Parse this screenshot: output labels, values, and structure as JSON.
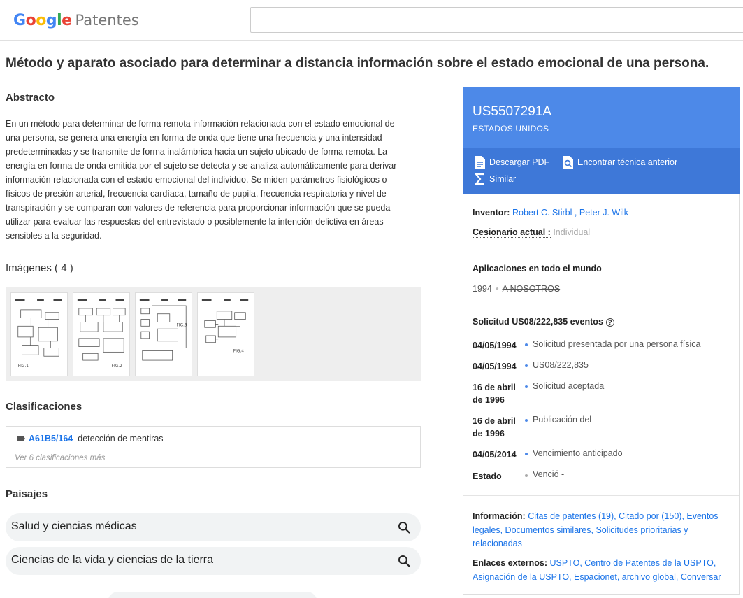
{
  "header": {
    "logo_google": "Google",
    "logo_patentes": "Patentes",
    "search_value": ""
  },
  "title": "Método y aparato asociado para determinar a distancia información sobre el estado emocional de una persona.",
  "abstract": {
    "heading": "Abstracto",
    "text": "En un método para determinar de forma remota información relacionada con el estado emocional de una persona, se genera una energía en forma de onda que tiene una frecuencia y una intensidad predeterminadas y se transmite de forma inalámbrica hacia un sujeto ubicado de forma remota. La energía en forma de onda emitida por el sujeto se detecta y se analiza automáticamente para derivar información relacionada con el estado emocional del individuo. Se miden parámetros fisiológicos o físicos de presión arterial, frecuencia cardíaca, tamaño de pupila, frecuencia respiratoria y nivel de transpiración y se comparan con valores de referencia para proporcionar información que se pueda utilizar para evaluar las respuestas del entrevistado o posiblemente la intención delictiva en áreas sensibles a la seguridad."
  },
  "images": {
    "heading": "Imágenes ( 4 )",
    "thumbnails": [
      "FIG.1",
      "FIG.2",
      "FIG.3",
      "FIG.4"
    ]
  },
  "classifications": {
    "heading": "Clasificaciones",
    "primary_code": "A61B5/164",
    "primary_desc": "detección de mentiras",
    "more": "Ver 6 clasificaciones más"
  },
  "landscapes": {
    "heading": "Paisajes",
    "items": [
      "Salud y ciencias médicas",
      "Ciencias de la vida y ciencias de la tierra"
    ]
  },
  "patent": {
    "number": "US5507291A",
    "country": "ESTADOS UNIDOS",
    "actions": {
      "download": "Descargar PDF",
      "prior_art": "Encontrar técnica anterior",
      "similar": "Similar"
    },
    "inventor_label": "Inventor:",
    "inventors": [
      "Robert C. Stirbl",
      "Peter J. Wilk"
    ],
    "assignee_label": "Cesionario actual :",
    "assignee": "Individual",
    "worldwide_heading": "Aplicaciones en todo el mundo",
    "worldwide_year": "1994",
    "worldwide_country": "A NOSOTROS",
    "application_heading": "Solicitud US08/222,835 eventos",
    "events": [
      {
        "date": "04/05/1994",
        "text": "Solicitud presentada por una persona física"
      },
      {
        "date": "04/05/1994",
        "text": "US08/222,835"
      },
      {
        "date": "16 de abril de 1996",
        "text": "Solicitud aceptada"
      },
      {
        "date": "16 de abril de 1996",
        "text": "Publicación del"
      },
      {
        "date": "04/05/2014",
        "text": "Vencimiento anticipado"
      },
      {
        "date": "Estado",
        "text": "Venció -"
      }
    ],
    "info_label": "Información:",
    "info_links": "Citas de patentes (19), Citado por (150), Eventos legales, Documentos similares, Solicitudes prioritarias y relacionadas",
    "external_label": "Enlaces externos:",
    "external_links": "USPTO, Centro de Patentes de la USPTO, Asignación de la USPTO, Espacionet, archivo global, Conversar"
  },
  "colors": {
    "accent": "#4d89e8",
    "accent_dark": "#3e78d8",
    "link": "#1a73e8"
  }
}
